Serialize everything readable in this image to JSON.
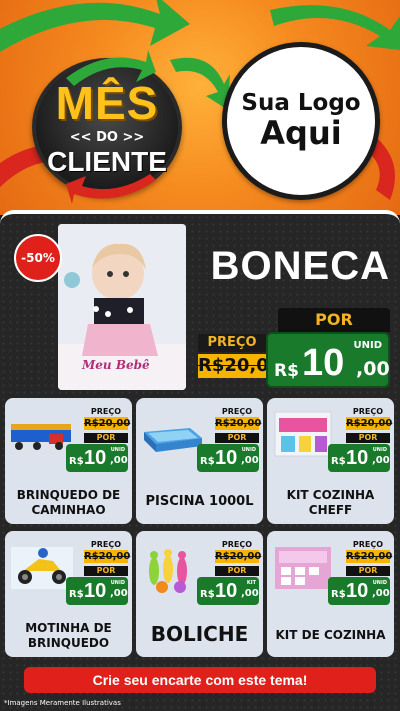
{
  "header": {
    "seal": {
      "line1": "MÊS",
      "line2": "<< DO >>",
      "line3": "CLIENTE"
    },
    "logo": {
      "line1": "Sua Logo",
      "line2": "Aqui"
    }
  },
  "hero": {
    "discount": "-50%",
    "title": "BONECA",
    "preco_label": "PREÇO",
    "old_price": "R$20,00",
    "por_label": "POR",
    "currency": "R$",
    "price_int": "10",
    "price_dec": ",00",
    "unit": "UNID",
    "box_text": "Meu Bebê"
  },
  "products": [
    {
      "name": "BRINQUEDO DE CAMINHAO",
      "preco_label": "PREÇO",
      "old_price": "R$20,00",
      "por_label": "POR",
      "currency": "R$",
      "price_int": "10",
      "price_dec": ",00",
      "unit": "UNID"
    },
    {
      "name": "PISCINA 1000L",
      "preco_label": "PREÇO",
      "old_price": "R$20,00",
      "por_label": "POR",
      "currency": "R$",
      "price_int": "10",
      "price_dec": ",00",
      "unit": "UNID"
    },
    {
      "name": "KIT COZINHA CHEFF",
      "preco_label": "PREÇO",
      "old_price": "R$20,00",
      "por_label": "POR",
      "currency": "R$",
      "price_int": "10",
      "price_dec": ",00",
      "unit": "UNID"
    },
    {
      "name": "MOTINHA DE BRINQUEDO",
      "preco_label": "PREÇO",
      "old_price": "R$20,00",
      "por_label": "POR",
      "currency": "R$",
      "price_int": "10",
      "price_dec": ",00",
      "unit": "UNID"
    },
    {
      "name": "BOLICHE",
      "preco_label": "PREÇO",
      "old_price": "R$20,00",
      "por_label": "POR",
      "currency": "R$",
      "price_int": "10",
      "price_dec": ",00",
      "unit": "KIT"
    },
    {
      "name": "KIT DE COZINHA",
      "preco_label": "PREÇO",
      "old_price": "R$20,00",
      "por_label": "POR",
      "currency": "R$",
      "price_int": "10",
      "price_dec": ",00",
      "unit": "UNID"
    }
  ],
  "cta": "Crie seu encarte com este tema!",
  "disclaimer": "*Imagens Meramente Ilustrativas",
  "colors": {
    "orange": "#f58a1f",
    "green": "#1a7a2b",
    "red": "#e0201b",
    "yellow": "#f6b400",
    "dark": "#262626"
  }
}
